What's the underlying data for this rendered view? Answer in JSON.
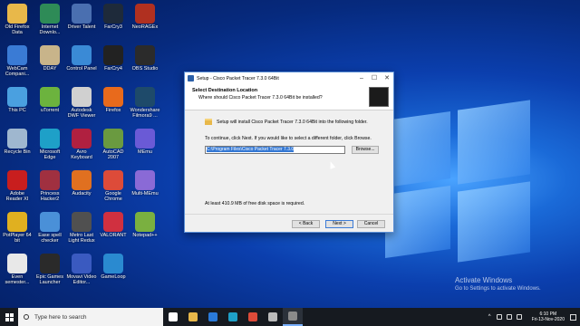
{
  "desktop_icons": [
    {
      "label": "Old Firefox Data",
      "icon": "folder-icon",
      "color": "#e8b84a"
    },
    {
      "label": "Internet Downlo...",
      "icon": "idm-icon",
      "color": "#2e8b57"
    },
    {
      "label": "Driver Talent",
      "icon": "driver-talent-icon",
      "color": "#4a6fb0"
    },
    {
      "label": "FarCry3",
      "icon": "farcry3-icon",
      "color": "#1e2a3a"
    },
    {
      "label": "NeoRAGEx",
      "icon": "neoragex-icon",
      "color": "#b03020"
    },
    {
      "label": "WebCam Compani...",
      "icon": "webcam-icon",
      "color": "#3a7bd5"
    },
    {
      "label": "DDAY",
      "icon": "dday-icon",
      "color": "#c8b48a"
    },
    {
      "label": "Control Panel",
      "icon": "control-panel-icon",
      "color": "#3a8ad6"
    },
    {
      "label": "FarCry4",
      "icon": "farcry4-icon",
      "color": "#222"
    },
    {
      "label": "OBS Studio",
      "icon": "obs-icon",
      "color": "#2b2b2b"
    },
    {
      "label": "This PC",
      "icon": "this-pc-icon",
      "color": "#4aa0e0"
    },
    {
      "label": "uTorrent",
      "icon": "utorrent-icon",
      "color": "#6cb33e"
    },
    {
      "label": "Autodesk DWF Viewer",
      "icon": "autodesk-dwf-icon",
      "color": "#d0d0d0"
    },
    {
      "label": "Firefox",
      "icon": "firefox-icon",
      "color": "#e86a1c"
    },
    {
      "label": "Wondershare Filmora9 ...",
      "icon": "filmora-icon",
      "color": "#1e4a6a"
    },
    {
      "label": "Recycle Bin",
      "icon": "recycle-bin-icon",
      "color": "#9fb7cf"
    },
    {
      "label": "Microsoft Edge",
      "icon": "edge-icon",
      "color": "#1ea0c8"
    },
    {
      "label": "Avro Keyboard",
      "icon": "avro-icon",
      "color": "#b02040"
    },
    {
      "label": "AutoCAD 2007",
      "icon": "autocad-icon",
      "color": "#6a9a40"
    },
    {
      "label": "MEmu",
      "icon": "memu-icon",
      "color": "#6a5ad6"
    },
    {
      "label": "Adobe Reader XI",
      "icon": "adobe-reader-icon",
      "color": "#c81e1e"
    },
    {
      "label": "Princess Hacker2",
      "icon": "princess-hacker-icon",
      "color": "#a03040"
    },
    {
      "label": "Audacity",
      "icon": "audacity-icon",
      "color": "#e07020"
    },
    {
      "label": "Google Chrome",
      "icon": "chrome-icon",
      "color": "#dd4b39"
    },
    {
      "label": "Multi-MEmu",
      "icon": "multi-memu-icon",
      "color": "#8a6ad6"
    },
    {
      "label": "PotPlayer 64 bit",
      "icon": "potplayer-icon",
      "color": "#e0b020"
    },
    {
      "label": "Ease spell checker",
      "icon": "spell-checker-icon",
      "color": "#4a90d8"
    },
    {
      "label": "Metro Last Light Redux",
      "icon": "metro-icon",
      "color": "#505050"
    },
    {
      "label": "VALORANT",
      "icon": "valorant-icon",
      "color": "#d03040"
    },
    {
      "label": "Notepad++",
      "icon": "notepad-plus-icon",
      "color": "#7ab040"
    },
    {
      "label": "Even semester...",
      "icon": "document-icon",
      "color": "#e8e8e8"
    },
    {
      "label": "Epic Games Launcher",
      "icon": "epic-games-icon",
      "color": "#2a2a2a"
    },
    {
      "label": "Movavi Video Editor...",
      "icon": "movavi-icon",
      "color": "#3a5ac0"
    },
    {
      "label": "GameLoop",
      "icon": "gameloop-icon",
      "color": "#2a8ad0"
    }
  ],
  "dialog": {
    "title": "Setup - Cisco Packet Tracer 7.3.0 64Bit",
    "minimize": "–",
    "maximize": "☐",
    "close": "✕",
    "header_title": "Select Destination Location",
    "header_subtitle": "Where should Cisco Packet Tracer 7.3.0 64Bit be installed?",
    "info": "Setup will install Cisco Packet Tracer 7.3.0 64Bit into the following folder.",
    "instruction": "To continue, click Next. If you would like to select a different folder, click Browse.",
    "path_value": "C:\\Program Files\\Cisco Packet Tracer 7.3.0",
    "browse_label": "Browse...",
    "space_required": "At least 410.9 MB of free disk space is required.",
    "back_label": "< Back",
    "next_label": "Next >",
    "cancel_label": "Cancel"
  },
  "watermark": {
    "line1": "Activate Windows",
    "line2": "Go to Settings to activate Windows."
  },
  "taskbar": {
    "search_placeholder": "Type here to search",
    "apps": [
      {
        "icon": "task-view-icon",
        "color": "#ffffff"
      },
      {
        "icon": "file-explorer-icon",
        "color": "#e8b84a"
      },
      {
        "icon": "store-icon",
        "color": "#2a7ad8"
      },
      {
        "icon": "edge-taskbar-icon",
        "color": "#1ea0c8"
      },
      {
        "icon": "chrome-taskbar-icon",
        "color": "#dd4b39"
      },
      {
        "icon": "obs-taskbar-icon",
        "color": "#bbbbbb"
      },
      {
        "icon": "setup-taskbar-icon",
        "color": "#8a8a8a"
      }
    ],
    "time": "6:10 PM",
    "date": "Fri-13-Nov-2020"
  }
}
